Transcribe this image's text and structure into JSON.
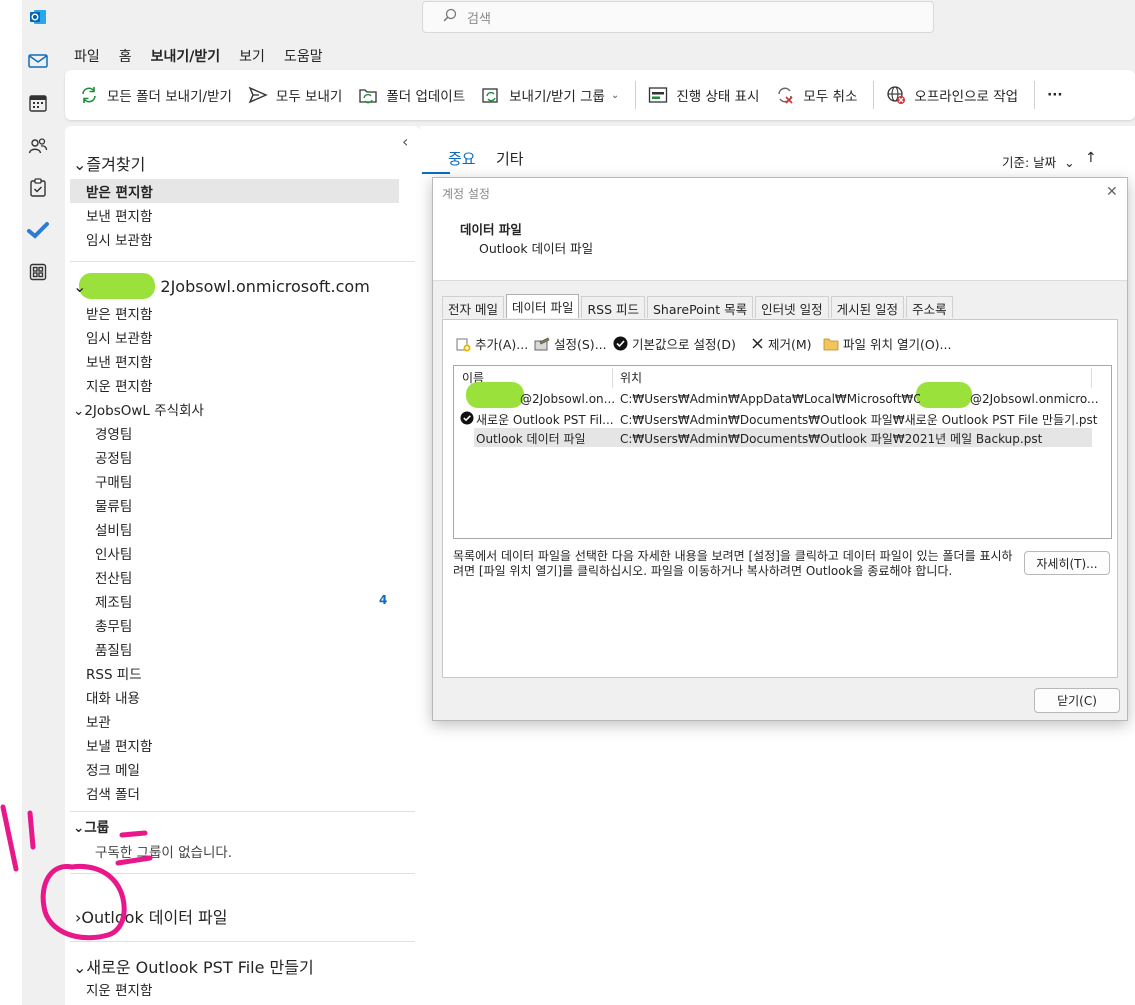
{
  "search": {
    "placeholder": "검색"
  },
  "menu": [
    {
      "label": "파일"
    },
    {
      "label": "홈"
    },
    {
      "label": "보내기/받기"
    },
    {
      "label": "보기"
    },
    {
      "label": "도움말"
    }
  ],
  "ribbon": {
    "send_receive_all": "모든 폴더 보내기/받기",
    "send_all": "모두 보내기",
    "update_folder": "폴더 업데이트",
    "send_receive_groups": "보내기/받기 그룹",
    "show_progress": "진행 상태 표시",
    "cancel_all": "모두 취소",
    "work_offline": "오프라인으로 작업",
    "more": "···"
  },
  "folders": {
    "collapse": "‹",
    "favorites": {
      "header": "즐겨찾기",
      "items": [
        "받은 편지함",
        "보낸 편지함",
        "임시 보관함"
      ]
    },
    "account": {
      "header": "2Jobsowl.onmicrosoft.com",
      "items": [
        "받은 편지함",
        "임시 보관함",
        "보낸 편지함",
        "지운 편지함"
      ],
      "org": {
        "label": "2JobsOwL 주식회사",
        "teams": [
          "경영팀",
          "공정팀",
          "구매팀",
          "물류팀",
          "설비팀",
          "인사팀",
          "전산팀",
          "제조팀",
          "총무팀",
          "품질팀"
        ],
        "badge": "4"
      },
      "more_items": [
        "RSS 피드",
        "대화 내용",
        "보관",
        "보낼 편지함",
        "정크 메일",
        "검색 폴더"
      ]
    },
    "groups": {
      "header": "그룹",
      "empty": "구독한 그룹이 없습니다."
    },
    "outlook_data": {
      "header": "Outlook 데이터 파일"
    },
    "new_pst": {
      "header": "새로운 Outlook PST File 만들기",
      "items": [
        "지운 편지함"
      ]
    }
  },
  "mail_list": {
    "tabs": [
      "중요",
      "기타"
    ],
    "sort_label": "기준: 날짜",
    "sort_arrow": "↑"
  },
  "dialog": {
    "title": "계정 설정",
    "heading": "데이터 파일",
    "subheading": "Outlook 데이터 파일",
    "close": "✕",
    "tabs": [
      "전자 메일",
      "데이터 파일",
      "RSS 피드",
      "SharePoint 목록",
      "인터넷 일정",
      "게시된 일정",
      "주소록"
    ],
    "toolbar": {
      "add": "추가(A)...",
      "settings": "설정(S)...",
      "set_default": "기본값으로 설정(D)",
      "remove": "제거(M)",
      "open_location": "파일 위치 열기(O)..."
    },
    "columns": {
      "name": "이름",
      "location": "위치"
    },
    "rows": [
      {
        "name": "@2Jobsowl.on...",
        "location": "C:₩Users₩Admin₩AppData₩Local₩Microsoft₩Outlook₩",
        "location_tail": "@2Jobsowl.onmicro..."
      },
      {
        "name": "새로운 Outlook PST Fil...",
        "location": "C:₩Users₩Admin₩Documents₩Outlook 파일₩새로운 Outlook PST File 만들기.pst"
      },
      {
        "name": "Outlook 데이터 파일",
        "location": "C:₩Users₩Admin₩Documents₩Outlook 파일₩2021년 메일 Backup.pst"
      }
    ],
    "description": "목록에서 데이터 파일을 선택한 다음 자세한 내용을 보려면 [설정]을 클릭하고 데이터 파일이 있는 폴더를 표시하려면 [파일 위치 열기]를 클릭하십시오. 파일을 이동하거나 복사하려면 Outlook을 종료해야 합니다.",
    "details_button": "자세히(T)...",
    "close_button": "닫기(C)"
  },
  "colors": {
    "accent": "#0f6cbd",
    "annotation": "#e8178a",
    "redaction": "#9be13b"
  }
}
